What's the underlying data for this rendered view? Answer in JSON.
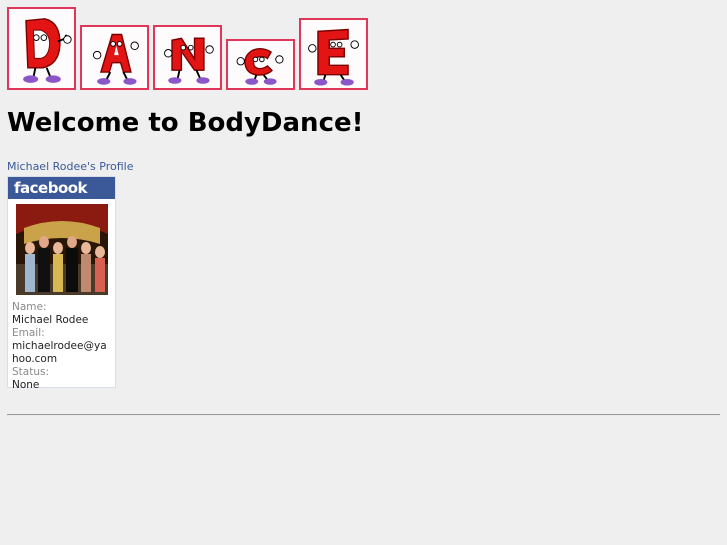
{
  "banner": {
    "letters": [
      "D",
      "A",
      "N",
      "C",
      "E"
    ],
    "colors": {
      "border": "#e0365a",
      "letter": "#e31414",
      "shoe": "#8b56c8"
    }
  },
  "page": {
    "title": "Welcome to BodyDance!"
  },
  "profile": {
    "link_text": "Michael Rodee's Profile",
    "brand": "facebook",
    "brand_color": "#3b5998",
    "fields": [
      {
        "label": "Name:",
        "value": "Michael Rodee"
      },
      {
        "label": "Email:",
        "value": "michaelrodee@yahoo.com"
      },
      {
        "label": "Status:",
        "value": "None"
      }
    ]
  }
}
